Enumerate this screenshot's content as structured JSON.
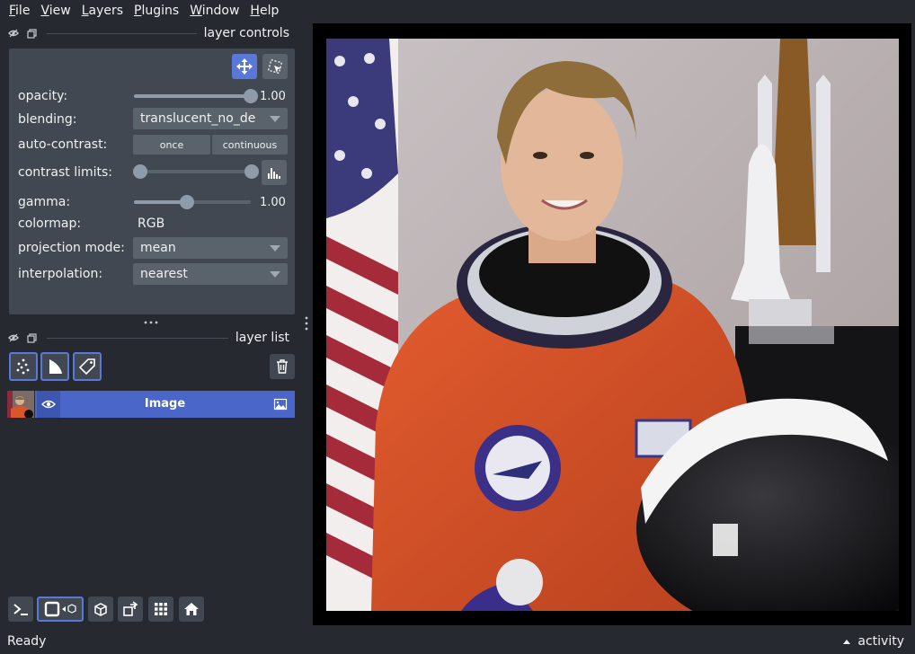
{
  "menu": [
    {
      "mnemonic": "F",
      "rest": "ile"
    },
    {
      "mnemonic": "V",
      "rest": "iew"
    },
    {
      "mnemonic": "L",
      "rest": "ayers"
    },
    {
      "mnemonic": "P",
      "rest": "lugins"
    },
    {
      "mnemonic": "W",
      "rest": "indow"
    },
    {
      "mnemonic": "H",
      "rest": "elp"
    }
  ],
  "layer_controls": {
    "title": "layer controls",
    "opacity": {
      "label": "opacity:",
      "value": "1.00",
      "fraction": 1.0
    },
    "blending": {
      "label": "blending:",
      "value": "translucent_no_de"
    },
    "auto_contrast": {
      "label": "auto-contrast:",
      "once": "once",
      "continuous": "continuous"
    },
    "contrast_limits": {
      "label": "contrast limits:",
      "low": 0.0,
      "high": 1.0
    },
    "gamma": {
      "label": "gamma:",
      "value": "1.00",
      "fraction": 0.45
    },
    "colormap": {
      "label": "colormap:",
      "value": "RGB"
    },
    "projection": {
      "label": "projection mode:",
      "value": "mean"
    },
    "interpolation": {
      "label": "interpolation:",
      "value": "nearest"
    }
  },
  "layer_list": {
    "title": "layer list",
    "layers": [
      {
        "name": "Image"
      }
    ]
  },
  "status": {
    "left": "Ready",
    "activity": "activity"
  },
  "colors": {
    "accent": "#5a78d8",
    "layer_selected": "#4a66c8",
    "panel_bg": "#414851",
    "window_bg": "#262930"
  }
}
